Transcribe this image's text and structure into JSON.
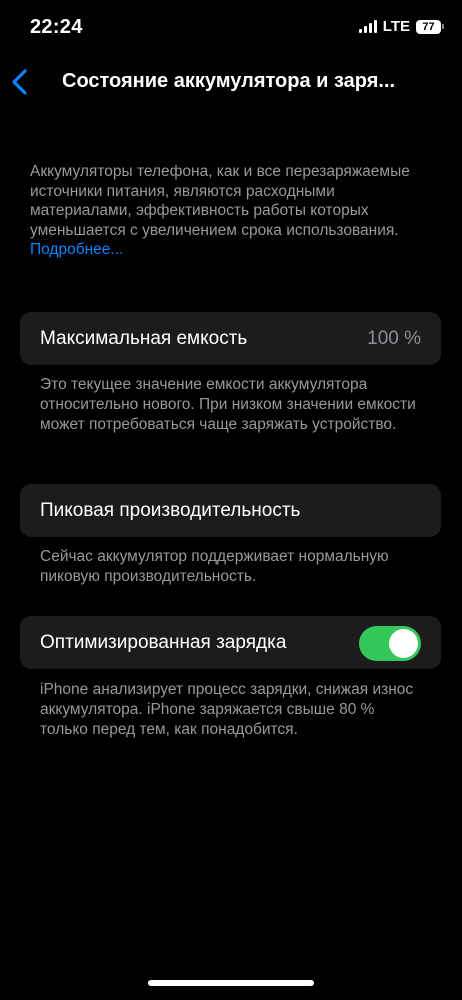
{
  "status_bar": {
    "time": "22:24",
    "network": "LTE",
    "battery_level": "77"
  },
  "nav": {
    "back_icon": "chevron-left-icon",
    "title": "Состояние аккумулятора и заря..."
  },
  "intro": {
    "text": "Аккумуляторы телефона, как и все перезаряжаемые источники питания, являются расходными материалами, эффективность работы которых уменьшается с увеличением срока использования.",
    "link": "Подробнее..."
  },
  "max_capacity": {
    "label": "Максимальная емкость",
    "value": "100 %",
    "footnote": "Это текущее значение емкости аккумулятора относительно нового. При низком значении емкости может потребоваться чаще заряжать устройство."
  },
  "peak_performance": {
    "label": "Пиковая производительность",
    "footnote": "Сейчас аккумулятор поддерживает нормальную пиковую производительность."
  },
  "optimized_charging": {
    "label": "Оптимизированная зарядка",
    "enabled": true,
    "footnote": "iPhone анализирует процесс зарядки, снижая износ аккумулятора. iPhone заряжается свыше 80 % только перед тем, как понадобится."
  },
  "colors": {
    "accent": "#0a84ff",
    "toggle_on": "#34c759",
    "card_bg": "#1c1c1e",
    "secondary_text": "#98989e"
  }
}
